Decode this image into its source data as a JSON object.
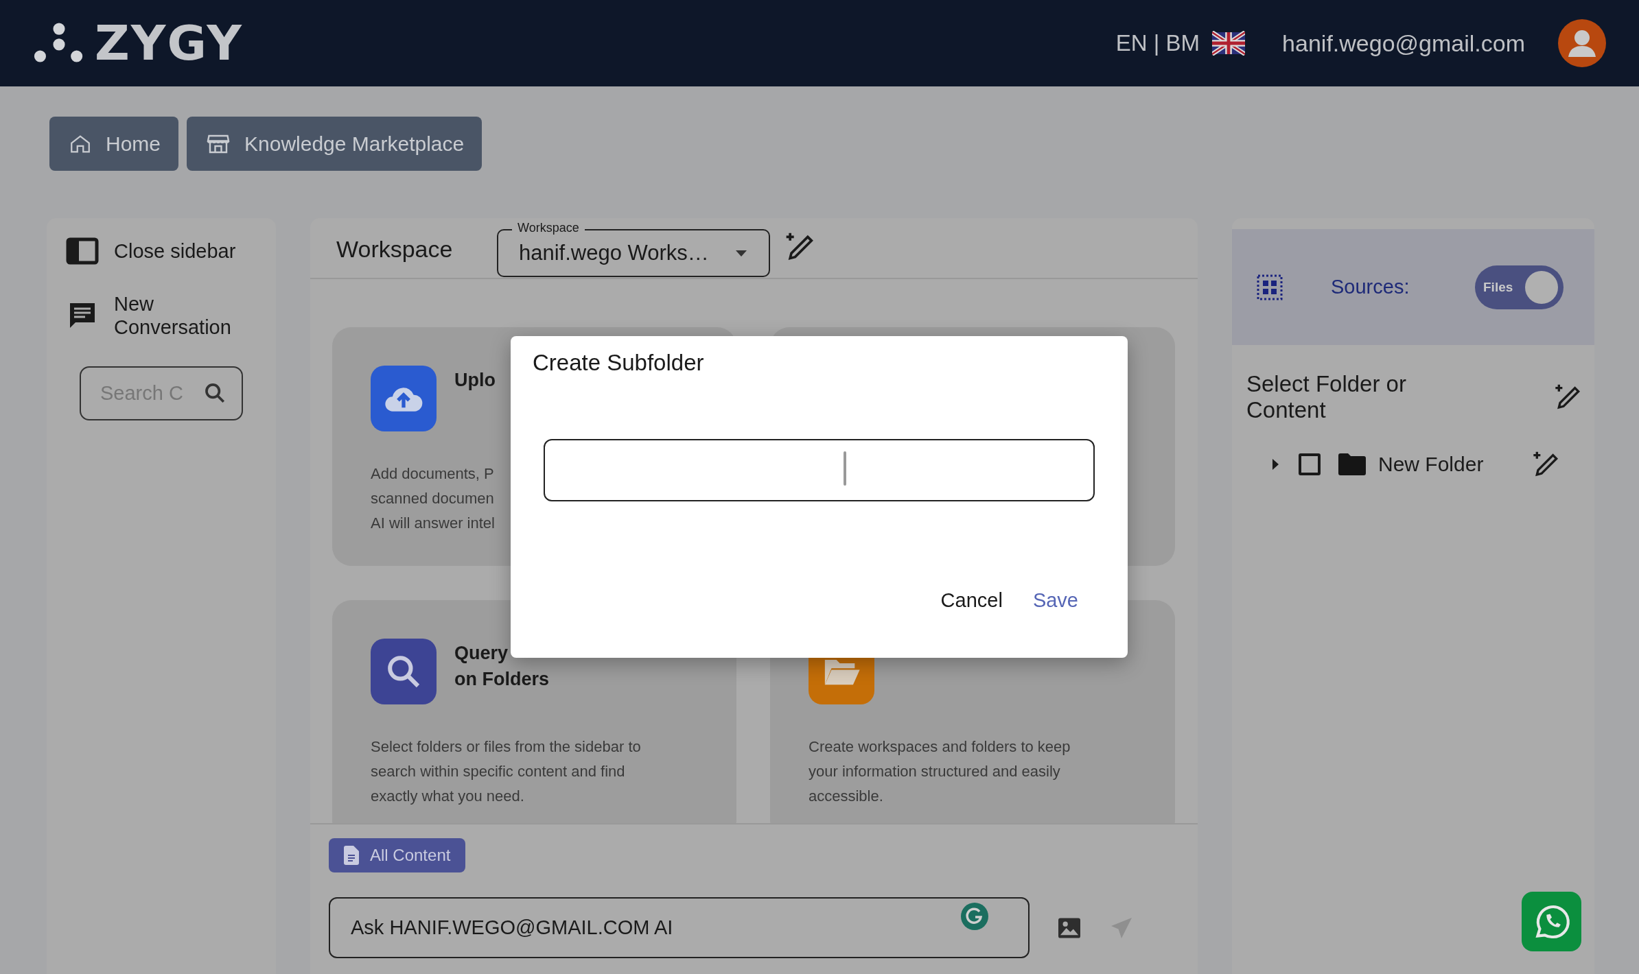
{
  "header": {
    "logo": "ZYGY",
    "language": "EN | BM",
    "email": "hanif.wego@gmail.com"
  },
  "nav": [
    {
      "label": "Home"
    },
    {
      "label": "Knowledge Marketplace"
    }
  ],
  "sidebar": {
    "items": [
      {
        "label": "Close sidebar"
      },
      {
        "label": "New Conversation"
      }
    ],
    "search": {
      "placeholder": "Search C"
    }
  },
  "workspace": {
    "title": "Workspace",
    "select_label": "Workspace",
    "select_value": "hanif.wego Works…"
  },
  "cards": [
    {
      "kind": "upload",
      "color": "#2a5bd0",
      "title_lines": [
        "Uplo"
      ],
      "text_lines": [
        "Add documents, P",
        "scanned documen",
        "AI will answer intel"
      ]
    },
    {
      "kind": "blank"
    },
    {
      "kind": "search",
      "color": "#3d4494",
      "title_lines": [
        "Query",
        "on Folders"
      ],
      "text_lines": [
        "Select folders or files from the sidebar to",
        "search within specific content and find",
        "exactly what you need."
      ]
    },
    {
      "kind": "folder",
      "color": "#c46e08",
      "text_lines": [
        "Create workspaces and folders to keep",
        "your information structured and easily",
        "accessible."
      ]
    }
  ],
  "chat": {
    "chip": "All Content",
    "placeholder": "Ask HANIF.WEGO@GMAIL.COM AI"
  },
  "sources": {
    "label": "Sources:",
    "toggle": {
      "label": "Files",
      "on": true
    },
    "title": "Select Folder or Content",
    "tree": [
      {
        "label": "New Folder",
        "checked": false,
        "expanded": false
      }
    ]
  },
  "dialog": {
    "title": "Create Subfolder",
    "buttons": [
      {
        "label": "Cancel",
        "kind": "plain"
      },
      {
        "label": "Save",
        "kind": "primary"
      }
    ]
  }
}
